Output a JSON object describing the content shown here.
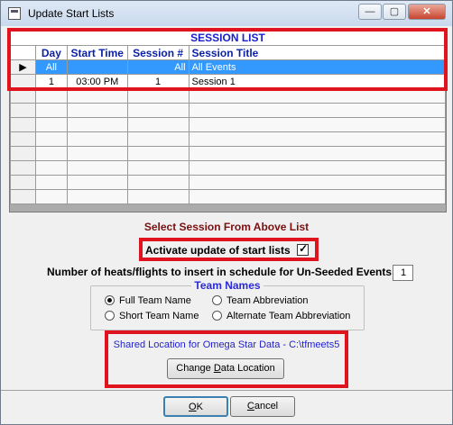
{
  "window": {
    "title": "Update Start Lists",
    "controls": {
      "minimize": "—",
      "maximize": "▢",
      "close": "✕"
    }
  },
  "grid": {
    "caption": "SESSION LIST",
    "columns": [
      "Day",
      "Start Time",
      "Session #",
      "Session Title"
    ],
    "row_indicator": "▶",
    "rows": [
      {
        "day": "All",
        "start_time": "",
        "session_no": "All",
        "title": "All Events"
      },
      {
        "day": "1",
        "start_time": "03:00 PM",
        "session_no": "1",
        "title": "Session 1"
      }
    ]
  },
  "select_label": "Select Session From Above List",
  "activate": {
    "label": "Activate update of start lists",
    "checked": true,
    "mark": "✓"
  },
  "heats": {
    "label": "Number of heats/flights to insert in schedule for Un-Seeded Events :",
    "value": "1"
  },
  "team_names": {
    "legend": "Team Names",
    "options": [
      {
        "label": "Full Team Name",
        "selected": true
      },
      {
        "label": "Team Abbreviation",
        "selected": false
      },
      {
        "label": "Short Team Name",
        "selected": false
      },
      {
        "label": "Alternate Team Abbreviation",
        "selected": false
      }
    ]
  },
  "shared_location": "Shared Location for Omega Star Data  -  C:\\tfmeets5",
  "buttons": {
    "change_location": {
      "pre": "Change ",
      "u": "D",
      "post": "ata Location"
    },
    "ok": {
      "pre": "",
      "u": "O",
      "post": "K"
    },
    "cancel": {
      "pre": "",
      "u": "C",
      "post": "ancel"
    }
  },
  "colors": {
    "highlight_box": "#e0141e",
    "selected_row": "#3399ff",
    "caption": "#1a21c9"
  }
}
